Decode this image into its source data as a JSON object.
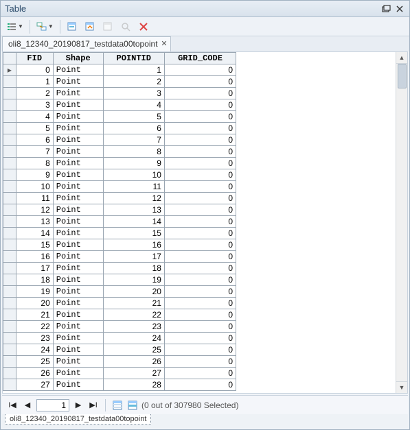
{
  "window": {
    "title": "Table"
  },
  "tab": {
    "title": "oli8_12340_20190817_testdata00topoint"
  },
  "columns": [
    "FID",
    "Shape",
    "POINTID",
    "GRID_CODE"
  ],
  "rows": [
    {
      "fid": 0,
      "shape": "Point",
      "pointid": 1,
      "gridcode": 0
    },
    {
      "fid": 1,
      "shape": "Point",
      "pointid": 2,
      "gridcode": 0
    },
    {
      "fid": 2,
      "shape": "Point",
      "pointid": 3,
      "gridcode": 0
    },
    {
      "fid": 3,
      "shape": "Point",
      "pointid": 4,
      "gridcode": 0
    },
    {
      "fid": 4,
      "shape": "Point",
      "pointid": 5,
      "gridcode": 0
    },
    {
      "fid": 5,
      "shape": "Point",
      "pointid": 6,
      "gridcode": 0
    },
    {
      "fid": 6,
      "shape": "Point",
      "pointid": 7,
      "gridcode": 0
    },
    {
      "fid": 7,
      "shape": "Point",
      "pointid": 8,
      "gridcode": 0
    },
    {
      "fid": 8,
      "shape": "Point",
      "pointid": 9,
      "gridcode": 0
    },
    {
      "fid": 9,
      "shape": "Point",
      "pointid": 10,
      "gridcode": 0
    },
    {
      "fid": 10,
      "shape": "Point",
      "pointid": 11,
      "gridcode": 0
    },
    {
      "fid": 11,
      "shape": "Point",
      "pointid": 12,
      "gridcode": 0
    },
    {
      "fid": 12,
      "shape": "Point",
      "pointid": 13,
      "gridcode": 0
    },
    {
      "fid": 13,
      "shape": "Point",
      "pointid": 14,
      "gridcode": 0
    },
    {
      "fid": 14,
      "shape": "Point",
      "pointid": 15,
      "gridcode": 0
    },
    {
      "fid": 15,
      "shape": "Point",
      "pointid": 16,
      "gridcode": 0
    },
    {
      "fid": 16,
      "shape": "Point",
      "pointid": 17,
      "gridcode": 0
    },
    {
      "fid": 17,
      "shape": "Point",
      "pointid": 18,
      "gridcode": 0
    },
    {
      "fid": 18,
      "shape": "Point",
      "pointid": 19,
      "gridcode": 0
    },
    {
      "fid": 19,
      "shape": "Point",
      "pointid": 20,
      "gridcode": 0
    },
    {
      "fid": 20,
      "shape": "Point",
      "pointid": 21,
      "gridcode": 0
    },
    {
      "fid": 21,
      "shape": "Point",
      "pointid": 22,
      "gridcode": 0
    },
    {
      "fid": 22,
      "shape": "Point",
      "pointid": 23,
      "gridcode": 0
    },
    {
      "fid": 23,
      "shape": "Point",
      "pointid": 24,
      "gridcode": 0
    },
    {
      "fid": 24,
      "shape": "Point",
      "pointid": 25,
      "gridcode": 0
    },
    {
      "fid": 25,
      "shape": "Point",
      "pointid": 26,
      "gridcode": 0
    },
    {
      "fid": 26,
      "shape": "Point",
      "pointid": 27,
      "gridcode": 0
    },
    {
      "fid": 27,
      "shape": "Point",
      "pointid": 28,
      "gridcode": 0
    }
  ],
  "nav": {
    "current": "1",
    "status": "(0 out of 307980 Selected)"
  },
  "bottom_tab": {
    "label": "oli8_12340_20190817_testdata00topoint"
  }
}
